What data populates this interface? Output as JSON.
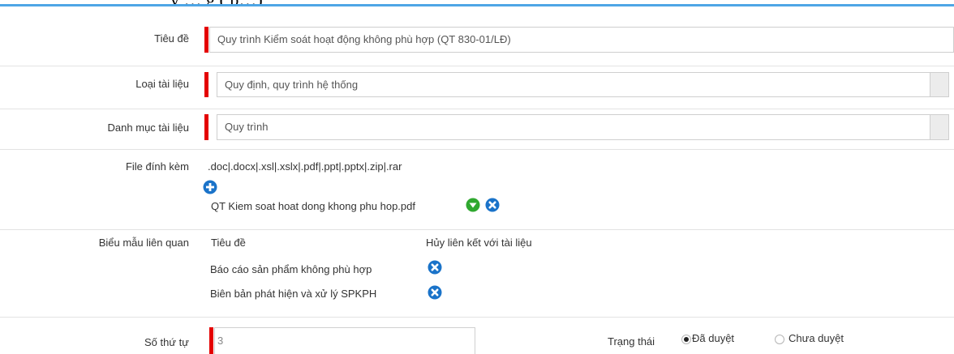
{
  "form": {
    "title": {
      "label": "Tiêu đề",
      "value": "Quy trình Kiểm soát hoạt động không phù hợp (QT 830-01/LĐ)"
    },
    "doc_type": {
      "label": "Loại tài liệu",
      "value": "Quy định, quy trình hệ thống"
    },
    "category": {
      "label": "Danh mục tài liệu",
      "value": "Quy trình"
    },
    "attachment": {
      "label": "File đính kèm",
      "allowed_types": ".doc|.docx|.xsl|.xslx|.pdf|.ppt|.pptx|.zip|.rar",
      "file_name": "QT Kiem soat hoat dong khong phu hop.pdf"
    },
    "related_forms": {
      "label": "Biểu mẫu liên quan",
      "col_title": "Tiêu đề",
      "col_unlink": "Hủy liên kết với tài liệu",
      "items": [
        {
          "title": "Báo cáo sản phẩm không phù hợp"
        },
        {
          "title": "Biên bản phát hiện và xử lý SPKPH"
        }
      ]
    },
    "order": {
      "label": "Số thứ tự",
      "value": "3"
    },
    "status": {
      "label": "Trạng thái",
      "options": [
        {
          "label": "Đã duyệt",
          "selected": true
        },
        {
          "label": "Chưa duyệt",
          "selected": false
        }
      ]
    }
  },
  "colors": {
    "required_marker": "#e40000",
    "icon_blue": "#1a73c9",
    "icon_green": "#2fa82f",
    "top_rule": "#4ea6e6"
  },
  "icons": [
    "add-icon",
    "download-icon",
    "remove-icon"
  ]
}
